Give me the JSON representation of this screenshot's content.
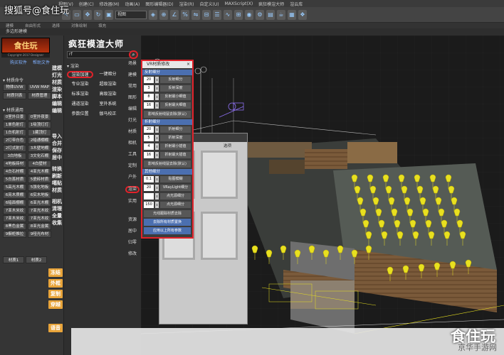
{
  "watermark_top": "搜狐号@食住玩",
  "menu": [
    "视图(V)",
    "创建(C)",
    "修改器(M)",
    "动画(A)",
    "图形编辑器(D)",
    "渲染(R)",
    "自定义(U)",
    "MAXScript(X)",
    "疯狂模渲大师",
    "渲云库"
  ],
  "toolbar": {
    "view_select": "视图"
  },
  "ribbon_tabs": [
    "建模",
    "自由形式",
    "选择",
    "对象绘制",
    "填充"
  ],
  "ribbon_sub": "多边形建模",
  "left_panel": {
    "logo_text": "食住玩",
    "logo_sub": "Copyright 2017 Designer",
    "links": [
      "购买软件",
      "帮助文件"
    ],
    "section_material": "材质命令",
    "material_buttons": [
      "物体UVW",
      "UVW MAP",
      "材质列表",
      "材质管理"
    ],
    "section_common": "材质通用",
    "common_buttons": [
      "0室外日景",
      "0室外夜景",
      "1单色射灯",
      "1吸顶灯灯",
      "1白机射灯",
      "1藏顶灯",
      "2灯带白色",
      "2暗通棚棚",
      "2灯式射灯",
      "3木壁地棚",
      "3白地板",
      "3文化石棚",
      "4地板砖材",
      "4白壁材",
      "4白石材棚",
      "4亚光木棚",
      "5白蒸材质",
      "5瓷砖材质",
      "5高光木棚",
      "5强化地板",
      "6亮木质棚",
      "6实木地板",
      "6暗面棚棚",
      "6亚光木棚",
      "7亚木米纹",
      "7亚光木纹",
      "7亚木米纹",
      "7亚光木纹",
      "8黑色金属",
      "8亚光金属",
      "9橱柜推拉",
      "9哑光布材"
    ],
    "side_labels": [
      "建模",
      "灯光",
      "材质",
      "渲染",
      "脚本",
      "编辑",
      "编辑"
    ],
    "side_labels2": [
      "导入",
      "合并",
      "保存",
      "居中",
      "转换",
      "刷新",
      "噶贴",
      "材质",
      "相机",
      "清理",
      "全量",
      "收集"
    ],
    "bottom_buttons": [
      "材质1",
      "材质2"
    ],
    "orange_buttons": [
      "冻结",
      "外框",
      "复制",
      "穿越",
      "语音"
    ]
  },
  "main_panel": {
    "title": "疯狂模渲大师",
    "search_value": "rf",
    "section": "渲染",
    "buttons": [
      "渲染加速",
      "一键暗分",
      "专业渲染",
      "超级渲染",
      "标准渲染",
      "高级渲染",
      "通道渲染",
      "室外系统",
      "参数位置",
      "伽马校正"
    ],
    "side_tabs": [
      "场景",
      "建模",
      "常用",
      "图形",
      "编辑",
      "灯光",
      "材质",
      "相机",
      "工具",
      "定制",
      "户外",
      "渲染",
      "实用",
      "资源",
      "居中",
      "归零",
      "修改"
    ]
  },
  "vr_dialog": {
    "title": "VR材质修改",
    "groups": [
      {
        "name": "反射细分",
        "rows": [
          {
            "v": "20",
            "l": "反射细分"
          },
          {
            "v": "3",
            "l": "反射深度"
          },
          {
            "v": "8",
            "l": "反射最小细值"
          },
          {
            "v": "16",
            "l": "反射最大细值"
          }
        ],
        "extra": "影响反射线鼠去除(默认)"
      },
      {
        "name": "折射细分",
        "rows": [
          {
            "v": "20",
            "l": "折射细分"
          },
          {
            "v": "5",
            "l": "折射深度"
          },
          {
            "v": "4",
            "l": "折射最小插值"
          },
          {
            "v": "16",
            "l": "折射最大插值"
          }
        ],
        "extra": "影响反射线鼠去除(默认)"
      },
      {
        "name": "其他细分",
        "rows": [
          {
            "v": "0.1",
            "l": "贴图模糊"
          },
          {
            "v": "20",
            "l": "VRayLight细分"
          },
          {
            "v": "",
            "l": "点光源细分"
          },
          {
            "v": "150",
            "l": "点光源细分"
          }
        ],
        "extra": "光线跟踪材质去除"
      }
    ],
    "blue_buttons": [
      "去除所有材质置换",
      "应用以上所有参数"
    ]
  },
  "material_window": {
    "tab_label": "选项"
  },
  "bottom_logo": "食住玩",
  "bottom_sub": "京华手游网"
}
